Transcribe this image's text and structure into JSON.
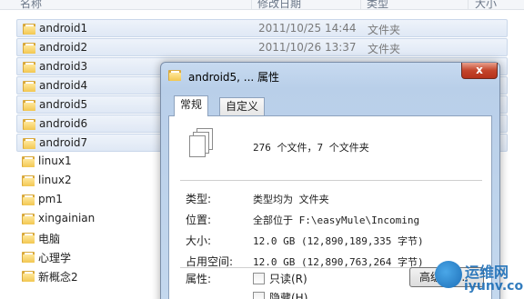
{
  "explorer": {
    "columns": {
      "name": "名称",
      "date": "修改日期",
      "type": "类型",
      "size": "大小"
    },
    "files": [
      {
        "name": "android1",
        "date": "2011/10/25 14:44",
        "type": "文件夹",
        "selected": true
      },
      {
        "name": "android2",
        "date": "2011/10/26 13:37",
        "type": "文件夹",
        "selected": true
      },
      {
        "name": "android3",
        "date": "",
        "type": "",
        "selected": true
      },
      {
        "name": "android4",
        "date": "",
        "type": "",
        "selected": true
      },
      {
        "name": "android5",
        "date": "",
        "type": "",
        "selected": true
      },
      {
        "name": "android6",
        "date": "",
        "type": "",
        "selected": true
      },
      {
        "name": "android7",
        "date": "",
        "type": "",
        "selected": true
      },
      {
        "name": "linux1",
        "date": "",
        "type": "",
        "selected": false
      },
      {
        "name": "linux2",
        "date": "",
        "type": "",
        "selected": false
      },
      {
        "name": "pm1",
        "date": "",
        "type": "",
        "selected": false
      },
      {
        "name": "xingainian",
        "date": "",
        "type": "",
        "selected": false
      },
      {
        "name": "电脑",
        "date": "",
        "type": "",
        "selected": false
      },
      {
        "name": "心理学",
        "date": "",
        "type": "",
        "selected": false
      },
      {
        "name": "新概念2",
        "date": "",
        "type": "",
        "selected": false
      }
    ]
  },
  "dialog": {
    "title": "android5, ... 属性",
    "close_glyph": "x",
    "tabs": [
      {
        "label": "常规",
        "active": true
      },
      {
        "label": "自定义",
        "active": false
      }
    ],
    "summary": "276 个文件，7 个文件夹",
    "properties": [
      {
        "label": "类型:",
        "value": "类型均为 文件夹"
      },
      {
        "label": "位置:",
        "value": "全部位于 F:\\easyMule\\Incoming"
      },
      {
        "label": "大小:",
        "value": "12.0 GB (12,890,189,335 字节)"
      },
      {
        "label": "占用空间:",
        "value": "12.0 GB (12,890,763,264 字节)"
      }
    ],
    "attributes_label": "属性:",
    "checkboxes": [
      {
        "label": "只读(R)",
        "checked": false
      },
      {
        "label": "隐藏(H)",
        "checked": false
      }
    ],
    "advanced_button": "高级(D)..."
  },
  "watermark": {
    "line1": "运维网",
    "line2": "iyunv.com"
  },
  "colors": {
    "selection": "#dfe8f5",
    "dialog_frame": "#b9cfe9",
    "close_button": "#c4452b",
    "watermark": "#1d6fb8"
  }
}
